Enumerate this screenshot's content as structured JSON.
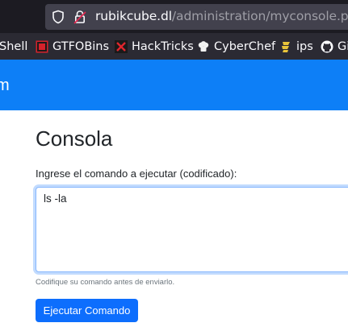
{
  "browser": {
    "url_host": "rubikcube.dl",
    "url_path": "/administration/myconsole.php",
    "bookmarks": [
      {
        "label": "Shell",
        "icon": "none"
      },
      {
        "label": "GTFOBins",
        "icon": "gtfobins-icon"
      },
      {
        "label": "HackTricks",
        "icon": "hacktricks-icon"
      },
      {
        "label": "CyberChef",
        "icon": "chef-hat-icon"
      },
      {
        "label": "ips",
        "icon": "ips-icon"
      },
      {
        "label": "Gi",
        "icon": "github-icon"
      }
    ]
  },
  "navbar": {
    "brand_fragment": "m",
    "color": "#0d7ff7"
  },
  "page": {
    "title": "Consola",
    "command_label": "Ingrese el comando a ejecutar (codificado):",
    "command_value": "ls -la",
    "help_text": "Codifique su comando antes de enviarlo.",
    "submit_label": "Ejecutar Comando",
    "button_color": "#0d6efd"
  }
}
